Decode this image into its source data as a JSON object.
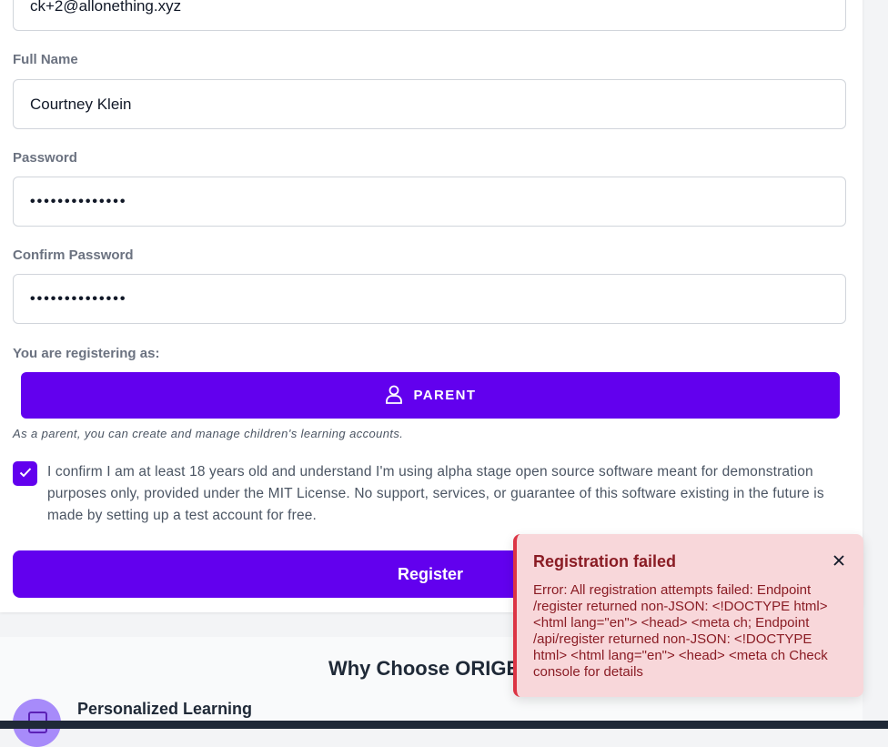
{
  "form": {
    "email_value": "ck+2@allonething.xyz",
    "full_name_label": "Full Name",
    "full_name_value": "Courtney Klein",
    "password_label": "Password",
    "password_value": "••••••••••••••",
    "confirm_password_label": "Confirm Password",
    "confirm_password_value": "••••••••••••••",
    "role_label": "You are registering as:",
    "role_button": "PARENT",
    "role_note": "As a parent, you can create and manage children's learning accounts.",
    "confirm_checked": true,
    "confirm_text": "I confirm I am at least 18 years old and understand I'm using alpha stage open source software meant for demonstration purposes only, provided under the MIT License. No support, services, or guarantee of this software existing in the future is made by setting up a test account for free.",
    "register_button": "Register"
  },
  "why": {
    "title": "Why Choose ORIGEN",
    "feature_title": "Personalized Learning"
  },
  "toast": {
    "title": "Registration failed",
    "body": "Error: All registration attempts failed: Endpoint /register returned non-JSON: <!DOCTYPE html> <html lang=\"en\"> <head> <meta ch; Endpoint /api/register returned non-JSON: <!DOCTYPE html> <html lang=\"en\"> <head> <meta ch Check console for details"
  },
  "colors": {
    "accent": "#6200ee",
    "error_bg": "#f8d7da",
    "error_border": "#dc3545",
    "error_text": "#8a1c24"
  }
}
